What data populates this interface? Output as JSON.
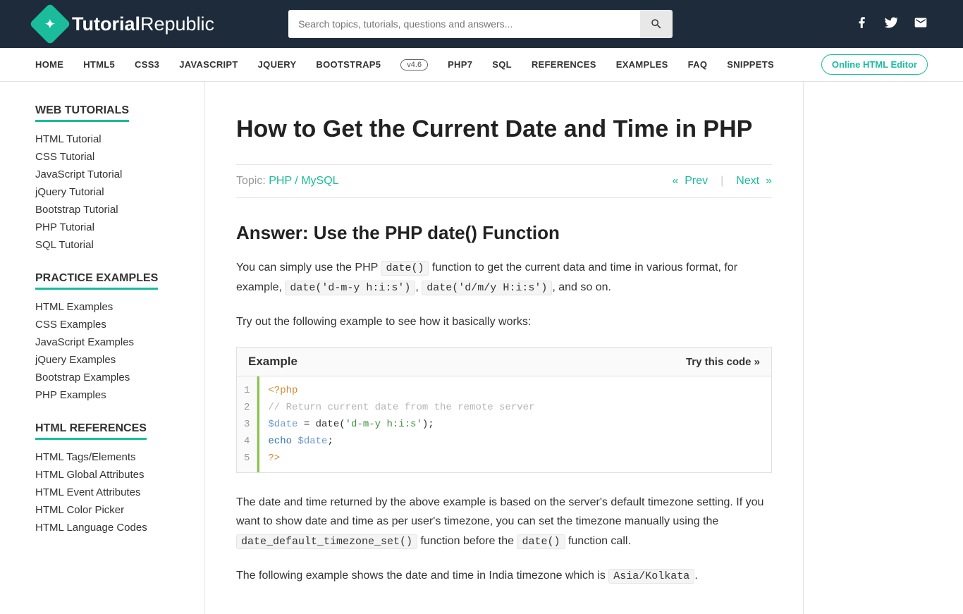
{
  "header": {
    "logo_a": "Tutorial",
    "logo_b": "Republic",
    "search_placeholder": "Search topics, tutorials, questions and answers..."
  },
  "nav": {
    "items": [
      "HOME",
      "HTML5",
      "CSS3",
      "JAVASCRIPT",
      "JQUERY",
      "BOOTSTRAP5",
      "PHP7",
      "SQL",
      "REFERENCES",
      "EXAMPLES",
      "FAQ",
      "SNIPPETS"
    ],
    "badge": "v4.6",
    "editor_btn": "Online HTML Editor"
  },
  "sidebar": {
    "h1": "WEB TUTORIALS",
    "list1": [
      "HTML Tutorial",
      "CSS Tutorial",
      "JavaScript Tutorial",
      "jQuery Tutorial",
      "Bootstrap Tutorial",
      "PHP Tutorial",
      "SQL Tutorial"
    ],
    "h2": "PRACTICE EXAMPLES",
    "list2": [
      "HTML Examples",
      "CSS Examples",
      "JavaScript Examples",
      "jQuery Examples",
      "Bootstrap Examples",
      "PHP Examples"
    ],
    "h3": "HTML REFERENCES",
    "list3": [
      "HTML Tags/Elements",
      "HTML Global Attributes",
      "HTML Event Attributes",
      "HTML Color Picker",
      "HTML Language Codes"
    ]
  },
  "article": {
    "title": "How to Get the Current Date and Time in PHP",
    "topic_label": "Topic: ",
    "topic_link": "PHP / MySQL",
    "prev": "Prev",
    "next": "Next",
    "answer_heading": "Answer: Use the PHP date() Function",
    "p1a": "You can simply use the PHP ",
    "p1_code1": "date()",
    "p1b": " function to get the current data and time in various format, for example, ",
    "p1_code2": "date('d-m-y h:i:s')",
    "p1c": ", ",
    "p1_code3": "date('d/m/y H:i:s')",
    "p1d": ", and so on.",
    "p2": "Try out the following example to see how it basically works:",
    "example_title": "Example",
    "try_code": "Try this code »",
    "code": {
      "l1": "<?php",
      "l2": "// Return current date from the remote server",
      "l3a": "$date",
      "l3b": " = date(",
      "l3c": "'d-m-y h:i:s'",
      "l3d": ");",
      "l4a": "echo",
      "l4b": " ",
      "l4c": "$date",
      "l4d": ";",
      "l5": "?>"
    },
    "p3a": "The date and time returned by the above example is based on the server's default timezone setting. If you want to show date and time as per user's timezone, you can set the timezone manually using the ",
    "p3_code1": "date_default_timezone_set()",
    "p3b": " function before the ",
    "p3_code2": "date()",
    "p3c": " function call.",
    "p4a": "The following example shows the date and time in India timezone which is ",
    "p4_code": "Asia/Kolkata",
    "p4b": "."
  }
}
